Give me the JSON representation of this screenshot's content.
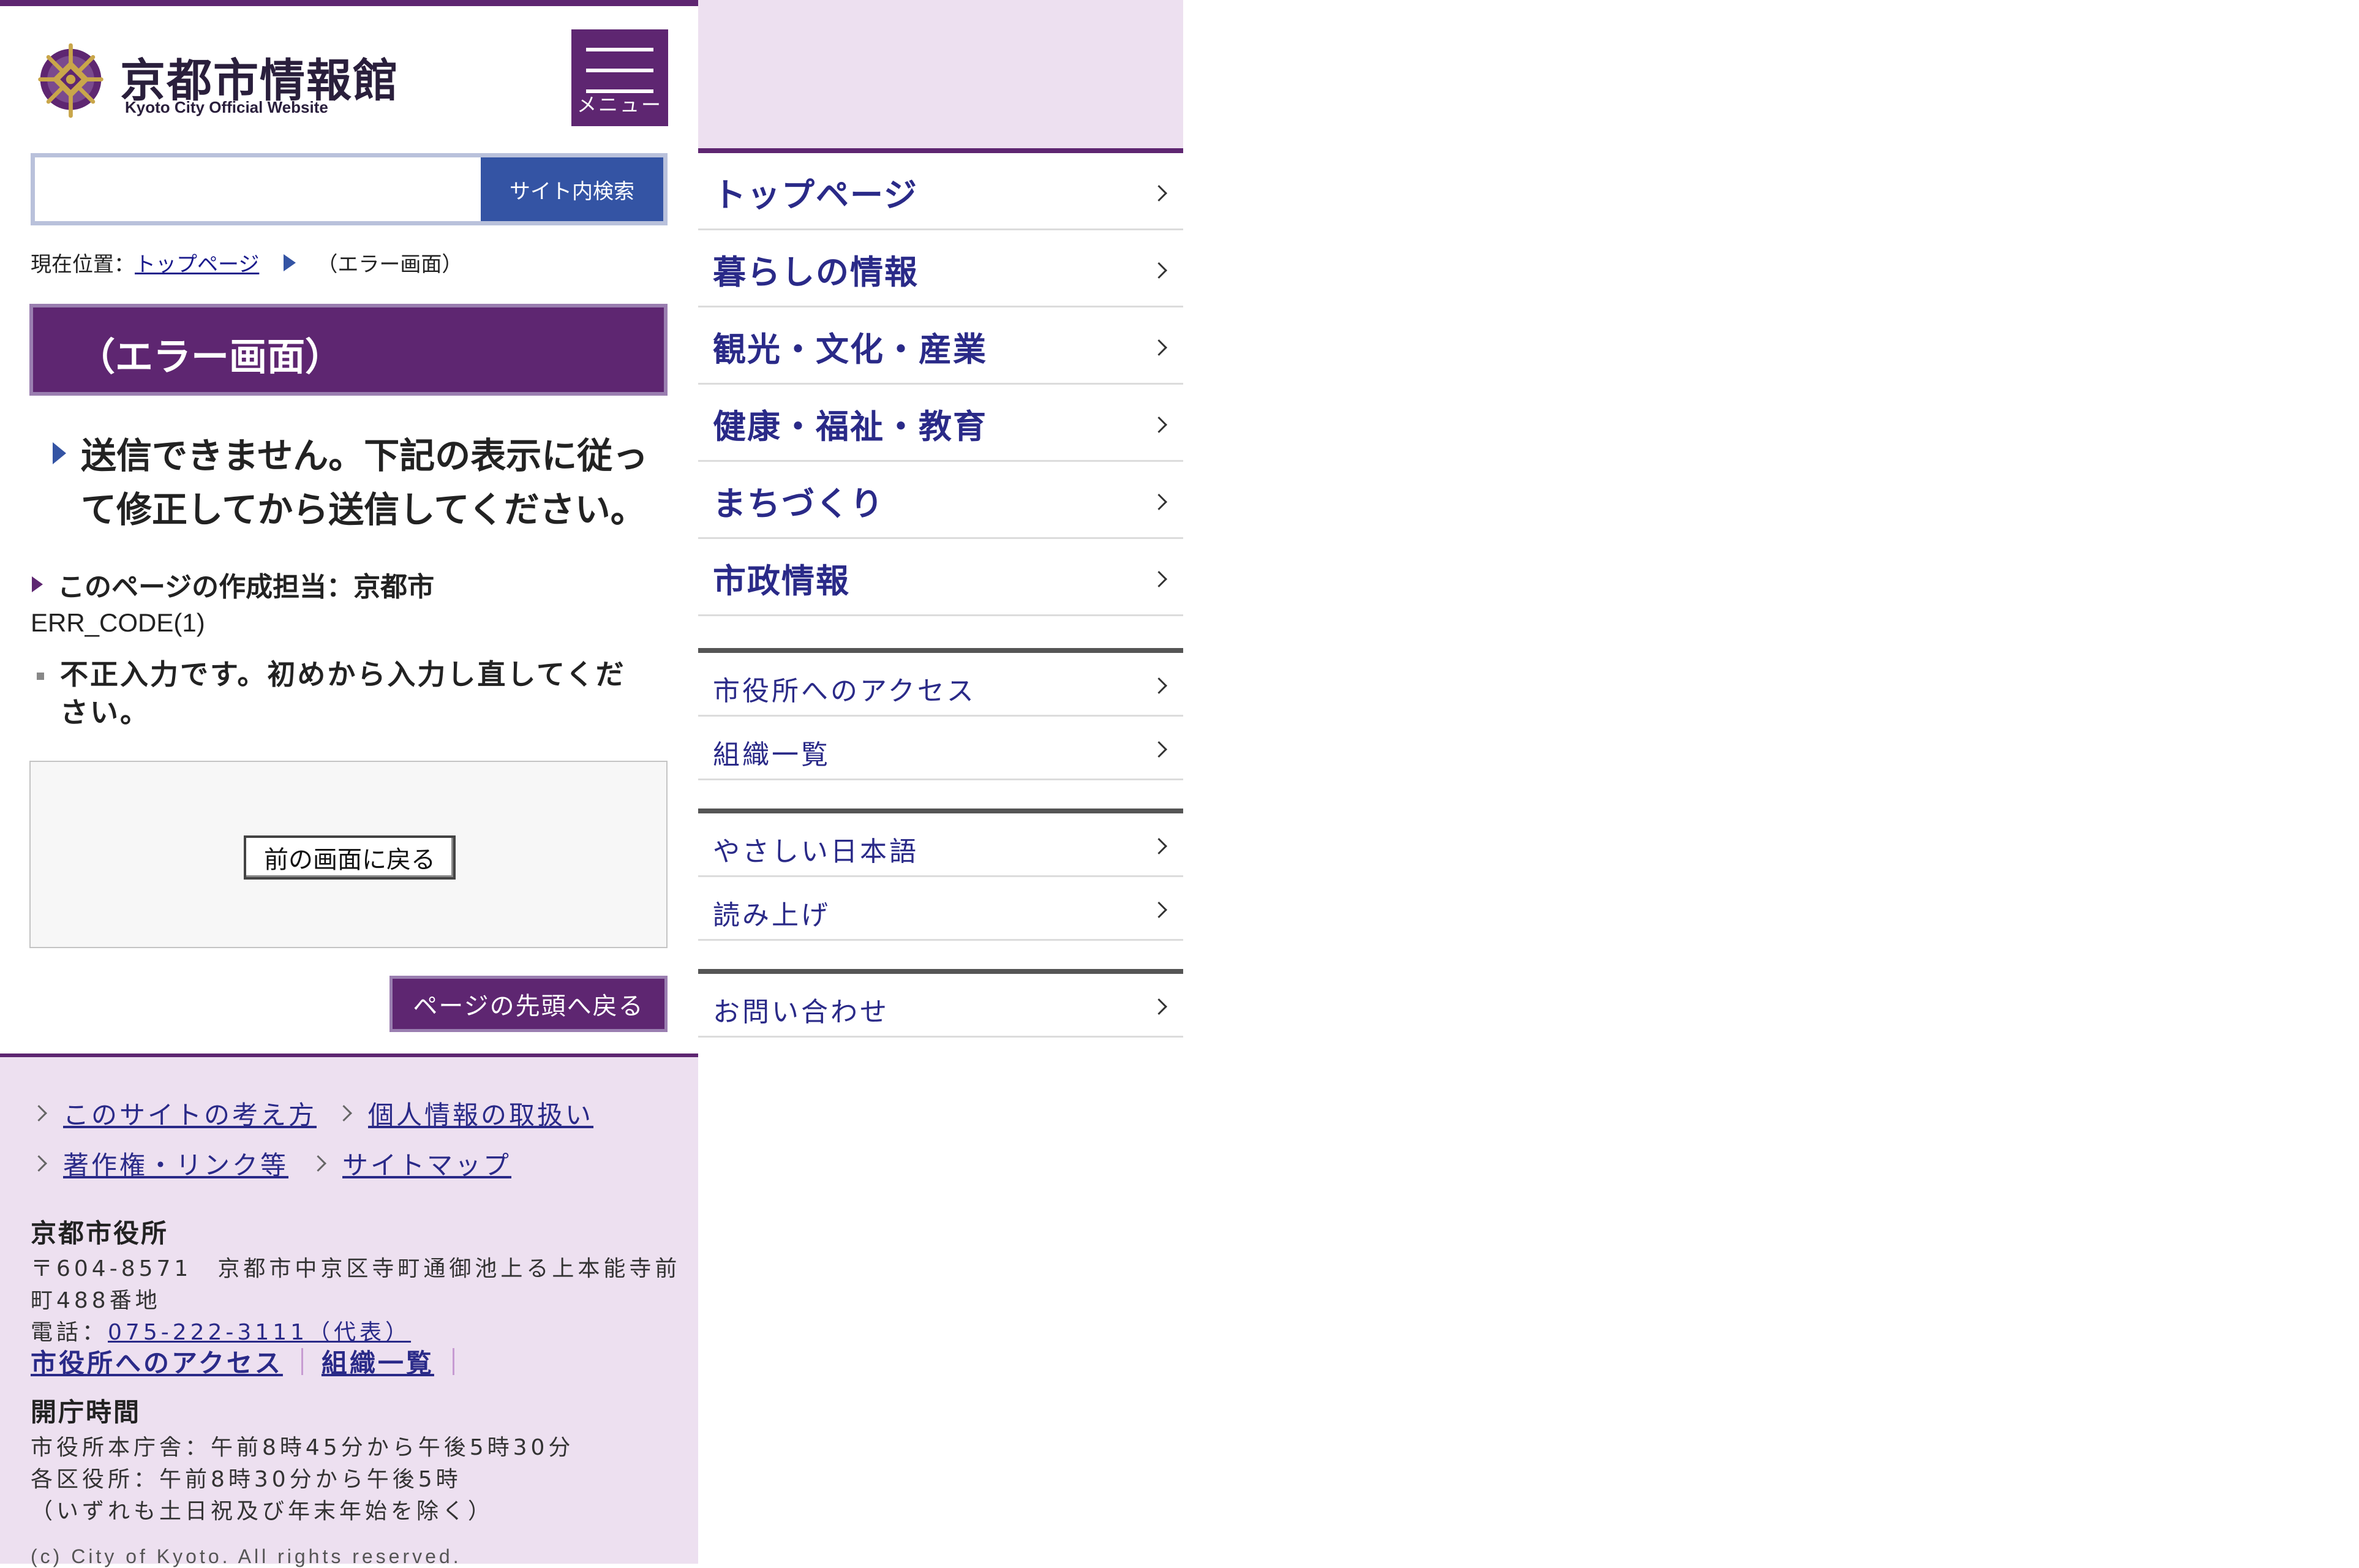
{
  "colors": {
    "brand": "#5e2671",
    "accent_blue": "#3454a4",
    "footer_bg": "#ede0f0",
    "link": "#2a2a88"
  },
  "header": {
    "logo_icon": "kyoto-city-emblem-icon",
    "logo_title": "京都市情報館",
    "logo_subtitle": "Kyoto City Official Website",
    "menu_label": "メニュー"
  },
  "search": {
    "value": "",
    "button_label": "サイト内検索"
  },
  "breadcrumb": {
    "prefix": "現在位置：",
    "home": "トップページ",
    "current": "（エラー画面）"
  },
  "main": {
    "title": "（エラー画面）",
    "heading": "送信できません。下記の表示に従って修正してから送信してください。",
    "author": "このページの作成担当：京都市",
    "error_code": "ERR_CODE(1)",
    "error_message": "不正入力です。初めから入力し直してください。",
    "back_button": "前の画面に戻る",
    "to_top_button": "ページの先頭へ戻る"
  },
  "footer": {
    "links": [
      "このサイトの考え方",
      "個人情報の取扱い",
      "著作権・リンク等",
      "サイトマップ"
    ],
    "office_name": "京都市役所",
    "address_line1": "〒604-8571　京都市中京区寺町通御池上る上本能寺前",
    "address_line2": "町488番地",
    "phone_prefix": "電話：",
    "phone": "075-222-3111（代表）",
    "quick_links": [
      "市役所へのアクセス",
      "組織一覧"
    ],
    "hours_title": "開庁時間",
    "hours_line1": "市役所本庁舎：午前8時45分から午後5時30分",
    "hours_line2": "各区役所：午前8時30分から午後5時",
    "hours_line3": "（いずれも土日祝及び年末年始を除く）",
    "copyright": "(c) City of Kyoto. All rights reserved."
  },
  "menu": {
    "main_items": [
      "トップページ",
      "暮らしの情報",
      "観光・文化・産業",
      "健康・福祉・教育",
      "まちづくり",
      "市政情報"
    ],
    "group1": [
      "市役所へのアクセス",
      "組織一覧"
    ],
    "group2": [
      "やさしい日本語",
      "読み上げ"
    ],
    "group3": [
      "お問い合わせ"
    ]
  }
}
